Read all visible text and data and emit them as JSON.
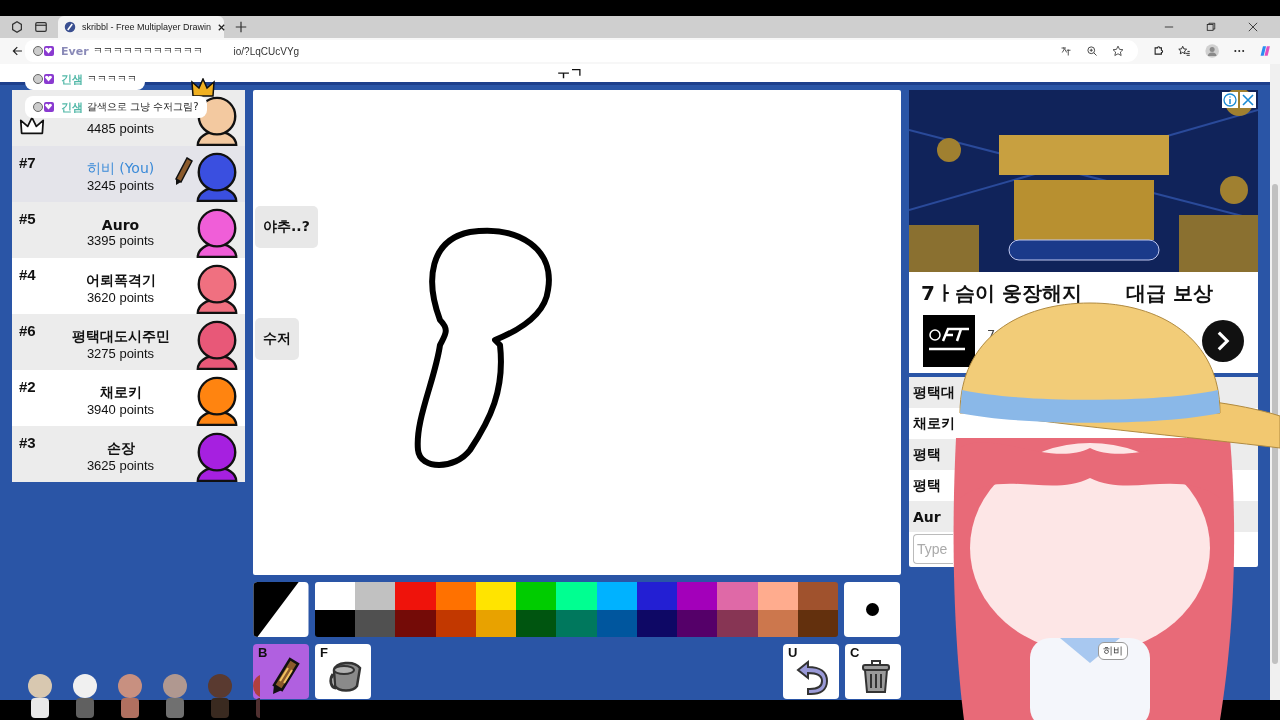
{
  "browser": {
    "tab_title": "skribbl - Free Multiplayer Drawin",
    "url": "io/?LqCUcVYg"
  },
  "word_hint": "ㅜㄱ",
  "stream_chat": [
    {
      "name": "Ever",
      "text": "ㅋㅋㅋㅋㅋㅋㅋㅋㅋㅋㅋ",
      "color": "#8a8ab8"
    },
    {
      "name": "긴샘",
      "text": "ㅋㅋㅋㅋㅋ",
      "color": "#52b8a8"
    },
    {
      "name": "긴샘",
      "text": "갈색으로 그냥 수저그림?",
      "color": "#52b8a8"
    }
  ],
  "players": [
    {
      "points": "4485 points",
      "crown": true,
      "you": false,
      "drawing": false,
      "color": "#f3c9a0"
    },
    {
      "rank": "#7",
      "name": "히비 (You)",
      "points": "3245 points",
      "crown": false,
      "you": true,
      "drawing": true,
      "color": "#3a4fe0"
    },
    {
      "rank": "#5",
      "name": "Auro",
      "points": "3395 points",
      "crown": false,
      "you": false,
      "drawing": false,
      "color": "#f05ed8",
      "bubble": "야추..?"
    },
    {
      "rank": "#4",
      "name": "어뢰폭격기",
      "points": "3620 points",
      "crown": false,
      "you": false,
      "drawing": false,
      "color": "#f07080"
    },
    {
      "rank": "#6",
      "name": "평택대도시주민",
      "points": "3275 points",
      "crown": false,
      "you": false,
      "drawing": false,
      "color": "#e85878",
      "bubble": "수저"
    },
    {
      "rank": "#2",
      "name": "채로키",
      "points": "3940 points",
      "crown": false,
      "you": false,
      "drawing": false,
      "color": "#ff8410"
    },
    {
      "rank": "#3",
      "name": "손장",
      "points": "3625 points",
      "crown": false,
      "you": false,
      "drawing": false,
      "color": "#a620e0"
    }
  ],
  "ad": {
    "kind": "picture",
    "headline_start": "7ㅏ슴이 웅장해지",
    "headline_end": "대급 보상",
    "subtitle": "7"
  },
  "chat": [
    {
      "name": "평택대"
    },
    {
      "name": "채로키"
    },
    {
      "name": "평택"
    },
    {
      "name": "평택"
    },
    {
      "name": "Aur"
    }
  ],
  "chat_input": {
    "placeholder": "Type"
  },
  "palette": [
    {
      "color": "#ffffff"
    },
    {
      "color": "#c1c1c1"
    },
    {
      "color": "#ef130b"
    },
    {
      "color": "#ff7100"
    },
    {
      "color": "#ffe400"
    },
    {
      "color": "#00cc00"
    },
    {
      "color": "#00ff91"
    },
    {
      "color": "#00b2ff"
    },
    {
      "color": "#231fd3"
    },
    {
      "color": "#a300ba"
    },
    {
      "color": "#df69a7"
    },
    {
      "color": "#ffac8e"
    },
    {
      "color": "#a0522d"
    },
    {
      "color": "#000000"
    },
    {
      "color": "#505050"
    },
    {
      "color": "#740b07"
    },
    {
      "color": "#c23800"
    },
    {
      "color": "#e8a200"
    },
    {
      "color": "#005510"
    },
    {
      "color": "#00785d"
    },
    {
      "color": "#00569e"
    },
    {
      "color": "#0e0865"
    },
    {
      "color": "#550069"
    },
    {
      "color": "#873554"
    },
    {
      "color": "#cc774d"
    },
    {
      "color": "#63300d"
    }
  ],
  "tools_left": [
    {
      "key": "B",
      "kind": "brush",
      "selected": true
    },
    {
      "key": "F",
      "kind": "fill",
      "selected": false
    }
  ],
  "tools_right": [
    {
      "key": "U",
      "kind": "undo",
      "selected": false
    },
    {
      "key": "C",
      "kind": "clear",
      "selected": false
    }
  ],
  "overlay_name_tag": "히비"
}
